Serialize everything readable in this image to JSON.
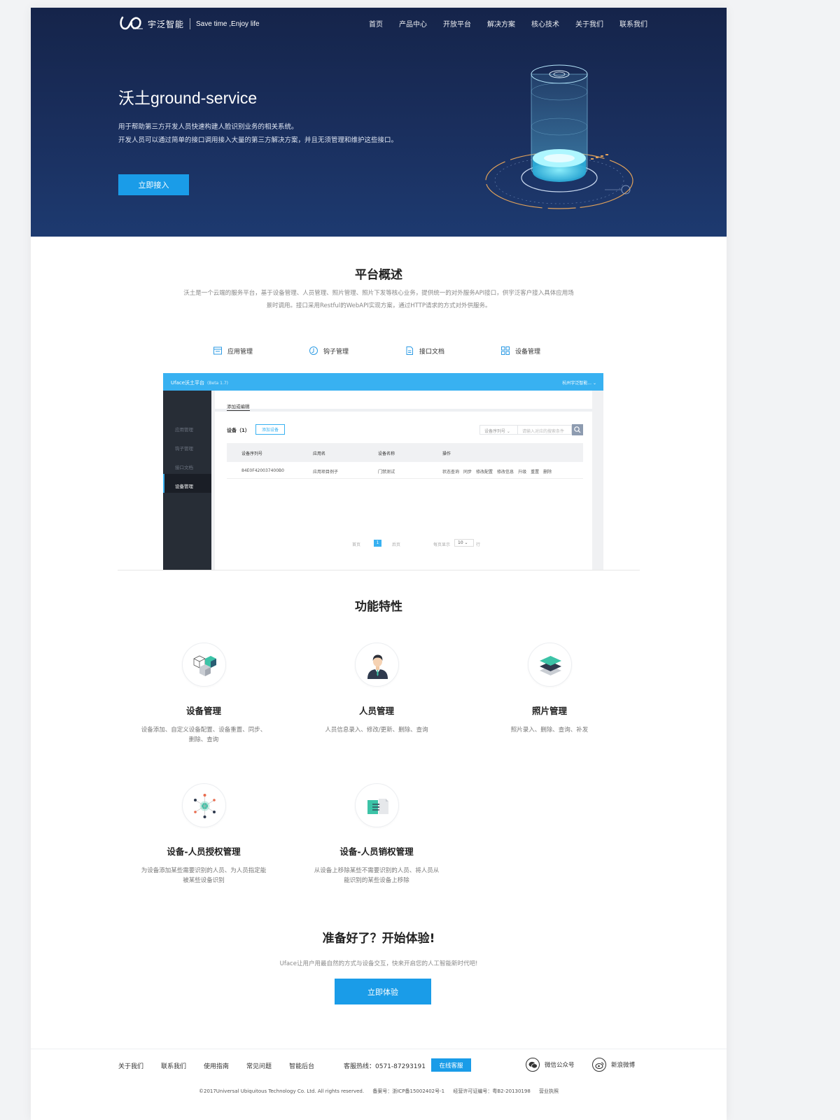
{
  "header": {
    "brand": "宇泛智能",
    "slogan": "Save time ,Enjoy life",
    "nav": [
      "首页",
      "产品中心",
      "开放平台",
      "解决方案",
      "核心技术",
      "关于我们",
      "联系我们"
    ]
  },
  "hero": {
    "title": "沃土ground-service",
    "desc_line1": "用于帮助第三方开发人员快速构建人脸识别业务的相关系统。",
    "desc_line2": "开发人员可以通过简单的接口调用接入大量的第三方解决方案，并且无须管理和维护这些接口。",
    "cta": "立即接入"
  },
  "overview": {
    "title": "平台概述",
    "desc_line1": "沃土是一个云端的服务平台，基于设备管理、人员管理、照片管理、照片下发等核心业务，提供统一的对外服务API接口，供宇泛客户接入具体应用场",
    "desc_line2": "景时调用。接口采用Restful的WebAPI实现方案，通过HTTP请求的方式对外供服务。",
    "tabs": [
      "应用管理",
      "钩子管理",
      "接口文档",
      "设备管理"
    ]
  },
  "mock": {
    "app_title": "Uface沃土平台",
    "beta": "(Beta 1.7)",
    "company": "杭州宇泛智能...",
    "side_items": [
      "应用管理",
      "钩子管理",
      "接口文档",
      "设备管理"
    ],
    "tab_label": "添加或编辑",
    "device_title": "设备（1）",
    "add_button": "添加设备",
    "select": "设备序列号",
    "search_placeholder": "请输入对应的搜索条件",
    "columns": [
      "设备序列号",
      "应用名",
      "设备名称",
      "操作"
    ],
    "row": {
      "serial": "84E0F420037400B0",
      "app": "应用项目例子",
      "name": "门禁测试",
      "ops": [
        "状态查询",
        "同步",
        "修改配置",
        "修改信息",
        "升级",
        "重置",
        "删除"
      ]
    },
    "pager": {
      "first": "首页",
      "current": "1",
      "last": "后页",
      "per_page": "每页显示",
      "per_value": "10",
      "unit": "行"
    }
  },
  "features": {
    "title": "功能特性",
    "items": [
      {
        "icon": "cubes-icon",
        "title": "设备管理",
        "desc": "设备添加、自定义设备配置、设备重置、同步、删除、查询"
      },
      {
        "icon": "person-icon",
        "title": "人员管理",
        "desc": "人员信息录入、修改/更新、删除、查询"
      },
      {
        "icon": "layers-icon",
        "title": "照片管理",
        "desc": "照片录入、删除、查询、补发"
      },
      {
        "icon": "network-icon",
        "title": "设备-人员授权管理",
        "desc": "为设备添加某些需要识别的人员、为人员指定能被某些设备识别"
      },
      {
        "icon": "revoke-icon",
        "title": "设备-人员销权管理",
        "desc": "从设备上移除某些不需要识别的人员、将人员从能识别的某些设备上移除"
      }
    ]
  },
  "ready": {
    "title": "准备好了？开始体验!",
    "desc": "Uface让用户用最自然的方式与设备交互，快来开启您的人工智能新时代吧!",
    "cta": "立即体验"
  },
  "footer": {
    "links": [
      "关于我们",
      "联系我们",
      "使用指南",
      "常见问题",
      "智能后台"
    ],
    "hotline": "客服热线：0571-87293191",
    "online": "在线客服",
    "wechat": "微信公众号",
    "weibo": "新浪微博",
    "copyright": "©2017Universal Ubiquitous Technology Co. Ltd. All rights reserved.",
    "icp": "备案号：浙ICP备15002402号-1",
    "license": "经营许可证编号：粤B2-20130198",
    "business": "营业执照"
  },
  "colors": {
    "hero_top": "#15244a",
    "hero_bottom": "#1d3a70",
    "accent": "#1a9ce8",
    "mock_bar": "#38b1f1",
    "mock_side": "#272d36"
  }
}
